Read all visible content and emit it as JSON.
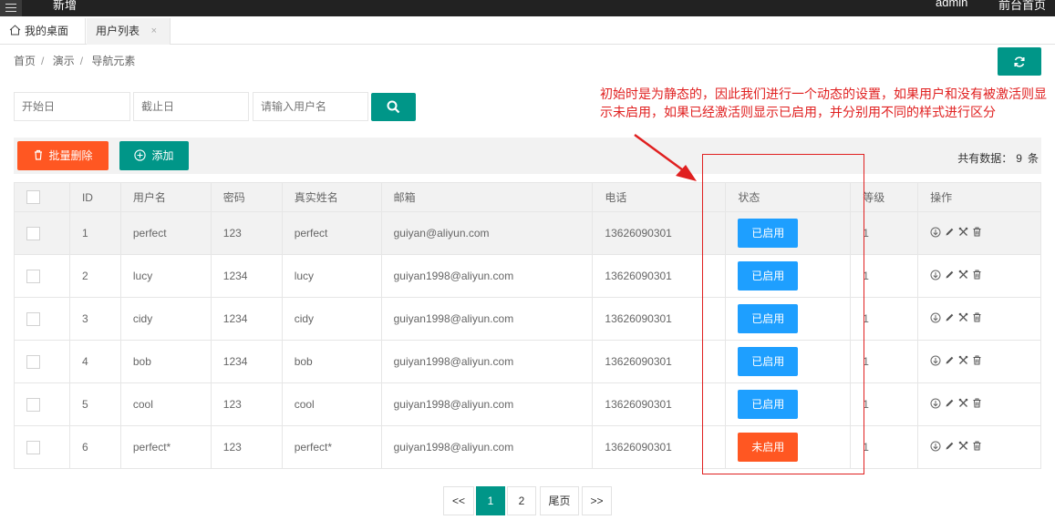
{
  "topbar": {
    "left_text": "新增",
    "user": "admin",
    "front": "前台首页"
  },
  "tabs": {
    "home": "我的桌面",
    "active": "用户列表",
    "close": "×"
  },
  "breadcrumb": {
    "items": [
      "首页",
      "演示",
      "导航元素"
    ],
    "sep": "/"
  },
  "search": {
    "start_placeholder": "开始日",
    "end_placeholder": "截止日",
    "name_placeholder": "请输入用户名"
  },
  "toolbar": {
    "delete_label": "批量删除",
    "add_label": "添加",
    "total_label": "共有数据：",
    "total_count": "9",
    "total_unit": "条"
  },
  "table": {
    "headers": [
      "ID",
      "用户名",
      "密码",
      "真实姓名",
      "邮箱",
      "电话",
      "状态",
      "等级",
      "操作"
    ],
    "rows": [
      {
        "id": "1",
        "username": "perfect",
        "password": "123",
        "realname": "perfect",
        "email": "guiyan@aliyun.com",
        "phone": "13626090301",
        "status": "已启用",
        "level": "1"
      },
      {
        "id": "2",
        "username": "lucy",
        "password": "1234",
        "realname": "lucy",
        "email": "guiyan1998@aliyun.com",
        "phone": "13626090301",
        "status": "已启用",
        "level": "1"
      },
      {
        "id": "3",
        "username": "cidy",
        "password": "1234",
        "realname": "cidy",
        "email": "guiyan1998@aliyun.com",
        "phone": "13626090301",
        "status": "已启用",
        "level": "1"
      },
      {
        "id": "4",
        "username": "bob",
        "password": "1234",
        "realname": "bob",
        "email": "guiyan1998@aliyun.com",
        "phone": "13626090301",
        "status": "已启用",
        "level": "1"
      },
      {
        "id": "5",
        "username": "cool",
        "password": "123",
        "realname": "cool",
        "email": "guiyan1998@aliyun.com",
        "phone": "13626090301",
        "status": "已启用",
        "level": "1"
      },
      {
        "id": "6",
        "username": "perfect*",
        "password": "123",
        "realname": "perfect*",
        "email": "guiyan1998@aliyun.com",
        "phone": "13626090301",
        "status": "未启用",
        "level": "1"
      }
    ]
  },
  "colors": {
    "teal": "#009688",
    "orange": "#ff5722",
    "blue": "#1e9fff",
    "annotation": "#e02020"
  },
  "annotation": "初始时是为静态的，因此我们进行一个动态的设置，如果用户和没有被激活则显示未启用，如果已经激活则显示已启用，并分别用不同的样式进行区分",
  "pagination": {
    "prev": "<<",
    "pages": [
      "1",
      "2"
    ],
    "current": "1",
    "last": "尾页",
    "next": ">>"
  }
}
